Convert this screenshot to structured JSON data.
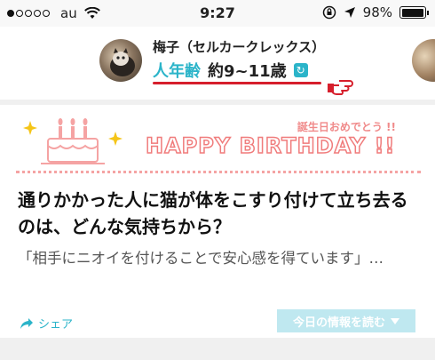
{
  "status_bar": {
    "carrier": "au",
    "time": "9:27",
    "battery": "98%",
    "battery_level": 0.98,
    "signal_filled": 1,
    "signal_total": 5
  },
  "profile": {
    "name": "梅子（セルカークレックス）",
    "age_label": "人年齢",
    "age_value": "約9~11歳",
    "accent_color": "#2bb4c9",
    "underline_color": "#d61f2c"
  },
  "banner": {
    "small_text": "誕生日おめでとう !!",
    "big_text": "HAPPY BIRTHDAY !!"
  },
  "article": {
    "title": "通りかかった人に猫が体をこすり付けて立ち去るのは、どんな気持ちから？",
    "excerpt": "「相手にニオイを付けることで安心感を得ています」…"
  },
  "actions": {
    "share_label": "シェア",
    "read_label": "今日の情報を読む"
  }
}
